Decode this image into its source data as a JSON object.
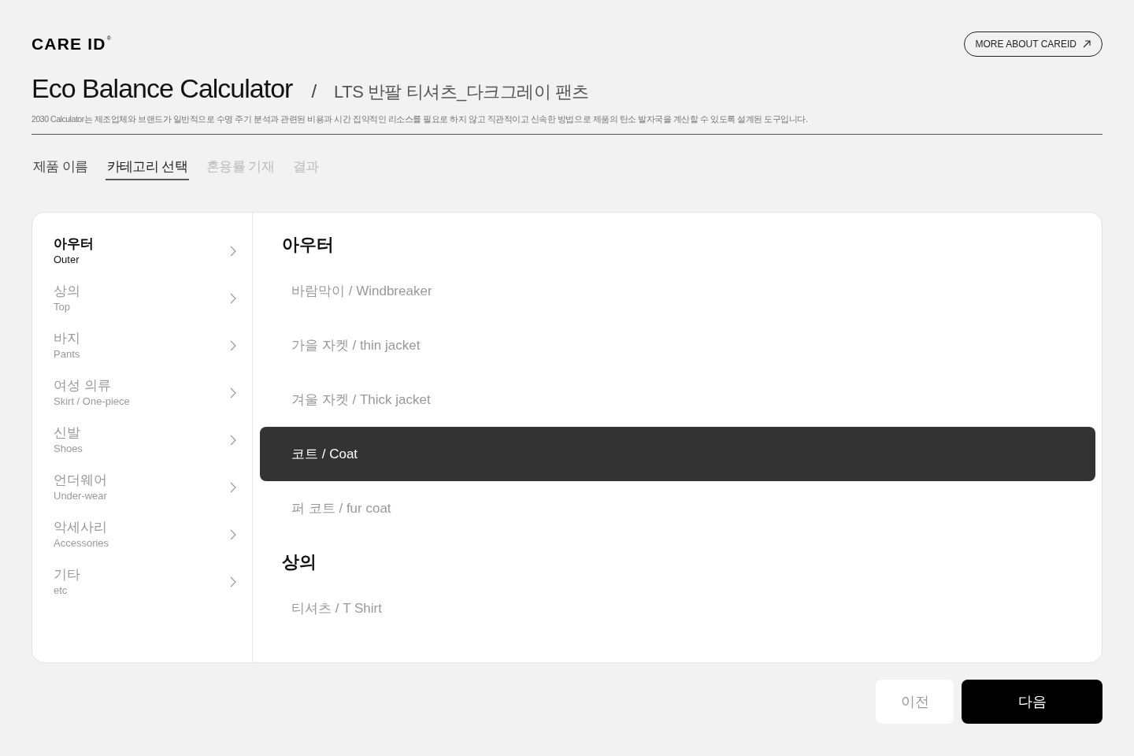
{
  "header": {
    "logo": "CARE ID",
    "logo_mark": "®",
    "link": "MORE ABOUT CAREID"
  },
  "title": {
    "name": "Eco Balance Calculator",
    "separator": "/",
    "product": "LTS 반팔 티셔츠_다크그레이 팬츠"
  },
  "description": "2030 Calculator는 제조업체와 브랜드가 일반적으로 수명 주기 분석과 관련된 비용과 시간 집약적인 리소스를 필요로 하지 않고 직관적이고 신속한 방법으로 제품의 탄소 발자국을 계산할 수 있도록 설계된 도구입니다.",
  "tabs": [
    {
      "label": "제품 이름",
      "selected": false,
      "disabled": false
    },
    {
      "label": "카테고리 선택",
      "selected": true,
      "disabled": false
    },
    {
      "label": "혼용률 기재",
      "selected": false,
      "disabled": true
    },
    {
      "label": "결과",
      "selected": false,
      "disabled": true
    }
  ],
  "sidebar": {
    "items": [
      {
        "label": "아우터",
        "sublabel": "Outer",
        "selected": true
      },
      {
        "label": "상의",
        "sublabel": "Top",
        "selected": false
      },
      {
        "label": "바지",
        "sublabel": "Pants",
        "selected": false
      },
      {
        "label": "여성 의류",
        "sublabel": "Skirt / One-piece",
        "selected": false
      },
      {
        "label": "신발",
        "sublabel": "Shoes",
        "selected": false
      },
      {
        "label": "언더웨어",
        "sublabel": "Under-wear",
        "selected": false
      },
      {
        "label": "악세사리",
        "sublabel": "Accessories",
        "selected": false
      },
      {
        "label": "기타",
        "sublabel": "etc",
        "selected": false
      }
    ]
  },
  "options": {
    "groups": [
      {
        "title": "아우터",
        "items": [
          {
            "label": "바람막이 / Windbreaker",
            "selected": false
          },
          {
            "label": "가을 자켓 / thin jacket",
            "selected": false
          },
          {
            "label": "겨울 자켓 / Thick jacket",
            "selected": false
          },
          {
            "label": "코트 / Coat",
            "selected": true
          },
          {
            "label": "퍼 코트 / fur coat",
            "selected": false
          }
        ]
      },
      {
        "title": "상의",
        "items": [
          {
            "label": "티셔츠 / T Shirt",
            "selected": false
          }
        ]
      }
    ]
  },
  "buttons": {
    "previous": "이전",
    "next": "다음"
  }
}
